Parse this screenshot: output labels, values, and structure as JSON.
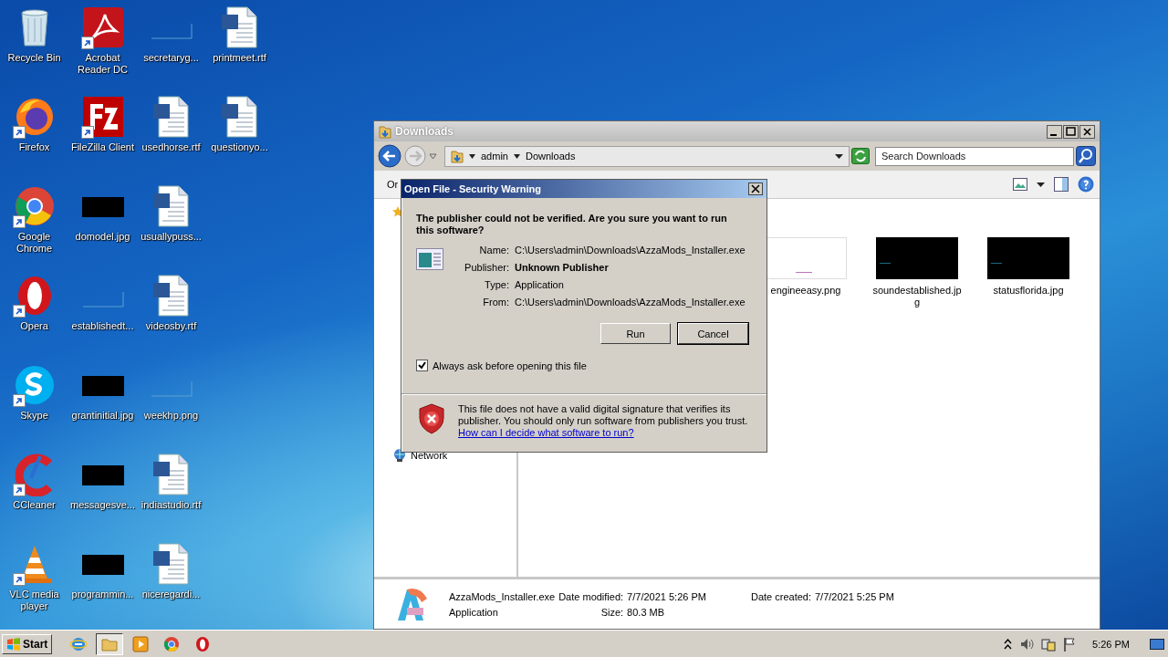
{
  "desktop": {
    "icons": [
      {
        "label": "Recycle Bin",
        "kind": "recycle",
        "shortcut": false
      },
      {
        "label": "Firefox",
        "kind": "firefox",
        "shortcut": true
      },
      {
        "label": "Google Chrome",
        "kind": "chrome",
        "shortcut": true
      },
      {
        "label": "Opera",
        "kind": "opera",
        "shortcut": true
      },
      {
        "label": "Skype",
        "kind": "skype",
        "shortcut": true
      },
      {
        "label": "CCleaner",
        "kind": "ccleaner",
        "shortcut": true
      },
      {
        "label": "VLC media player",
        "kind": "vlc",
        "shortcut": true
      },
      {
        "label": "Acrobat Reader DC",
        "kind": "acrobat",
        "shortcut": true
      },
      {
        "label": "FileZilla Client",
        "kind": "filezilla",
        "shortcut": true
      },
      {
        "label": "domodel.jpg",
        "kind": "dark-image",
        "shortcut": false
      },
      {
        "label": "establishedt...",
        "kind": "blank-image",
        "shortcut": false
      },
      {
        "label": "grantinitial.jpg",
        "kind": "dark-image",
        "shortcut": false
      },
      {
        "label": "messagesve...",
        "kind": "dark-image",
        "shortcut": false
      },
      {
        "label": "programmin...",
        "kind": "dark-image",
        "shortcut": false
      },
      {
        "label": "secretaryg...",
        "kind": "blank-image",
        "shortcut": false
      },
      {
        "label": "usedhorse.rtf",
        "kind": "document",
        "shortcut": false
      },
      {
        "label": "usuallypuss...",
        "kind": "document",
        "shortcut": false
      },
      {
        "label": "videosby.rtf",
        "kind": "document",
        "shortcut": false
      },
      {
        "label": "weekhp.png",
        "kind": "blank-image",
        "shortcut": false
      },
      {
        "label": "indiastudio.rtf",
        "kind": "document",
        "shortcut": false
      },
      {
        "label": "niceregardi...",
        "kind": "document",
        "shortcut": false
      },
      {
        "label": "printmeet.rtf",
        "kind": "document",
        "shortcut": false
      },
      {
        "label": "questionyo...",
        "kind": "document",
        "shortcut": false
      }
    ]
  },
  "explorer": {
    "title": "Downloads",
    "breadcrumb": [
      "admin",
      "Downloads"
    ],
    "search": {
      "placeholder": "Search Downloads"
    },
    "toolbar_text": "Or",
    "nav": [
      {
        "label": "Network"
      }
    ],
    "files": [
      {
        "name": "engineeasy.png",
        "kind": "light"
      },
      {
        "name": "soundestablished.jpg",
        "kind": "dark"
      },
      {
        "name": "statusflorida.jpg",
        "kind": "dark"
      }
    ],
    "details": {
      "name": "AzzaMods_Installer.exe",
      "type": "Application",
      "modified_label": "Date modified:",
      "modified": "7/7/2021 5:26 PM",
      "created_label": "Date created:",
      "created": "7/7/2021 5:25 PM",
      "size_label": "Size:",
      "size": "80.3 MB"
    }
  },
  "dialog": {
    "title": "Open File - Security Warning",
    "heading": "The publisher could not be verified.  Are you sure you want to run this software?",
    "fields": [
      {
        "label": "Name:",
        "value": "C:\\Users\\admin\\Downloads\\AzzaMods_Installer.exe",
        "emphasis": false
      },
      {
        "label": "Publisher:",
        "value": "Unknown Publisher",
        "emphasis": true
      },
      {
        "label": "Type:",
        "value": "Application",
        "emphasis": false
      },
      {
        "label": "From:",
        "value": "C:\\Users\\admin\\Downloads\\AzzaMods_Installer.exe",
        "emphasis": false
      }
    ],
    "buttons": [
      {
        "label": "Run",
        "default": false
      },
      {
        "label": "Cancel",
        "default": true
      }
    ],
    "checkbox": {
      "label": "Always ask before opening this file",
      "checked": true
    },
    "warning": "This file does not have a valid digital signature that verifies its publisher.  You should only run software from publishers you trust.",
    "link": "How can I decide what software to run?"
  },
  "taskbar": {
    "start": "Start",
    "apps": [
      {
        "kind": "ie",
        "active": false
      },
      {
        "kind": "folder",
        "active": true
      },
      {
        "kind": "media",
        "active": false
      },
      {
        "kind": "chrome",
        "active": false
      },
      {
        "kind": "opera",
        "active": false
      }
    ],
    "clock": "5:26 PM"
  }
}
